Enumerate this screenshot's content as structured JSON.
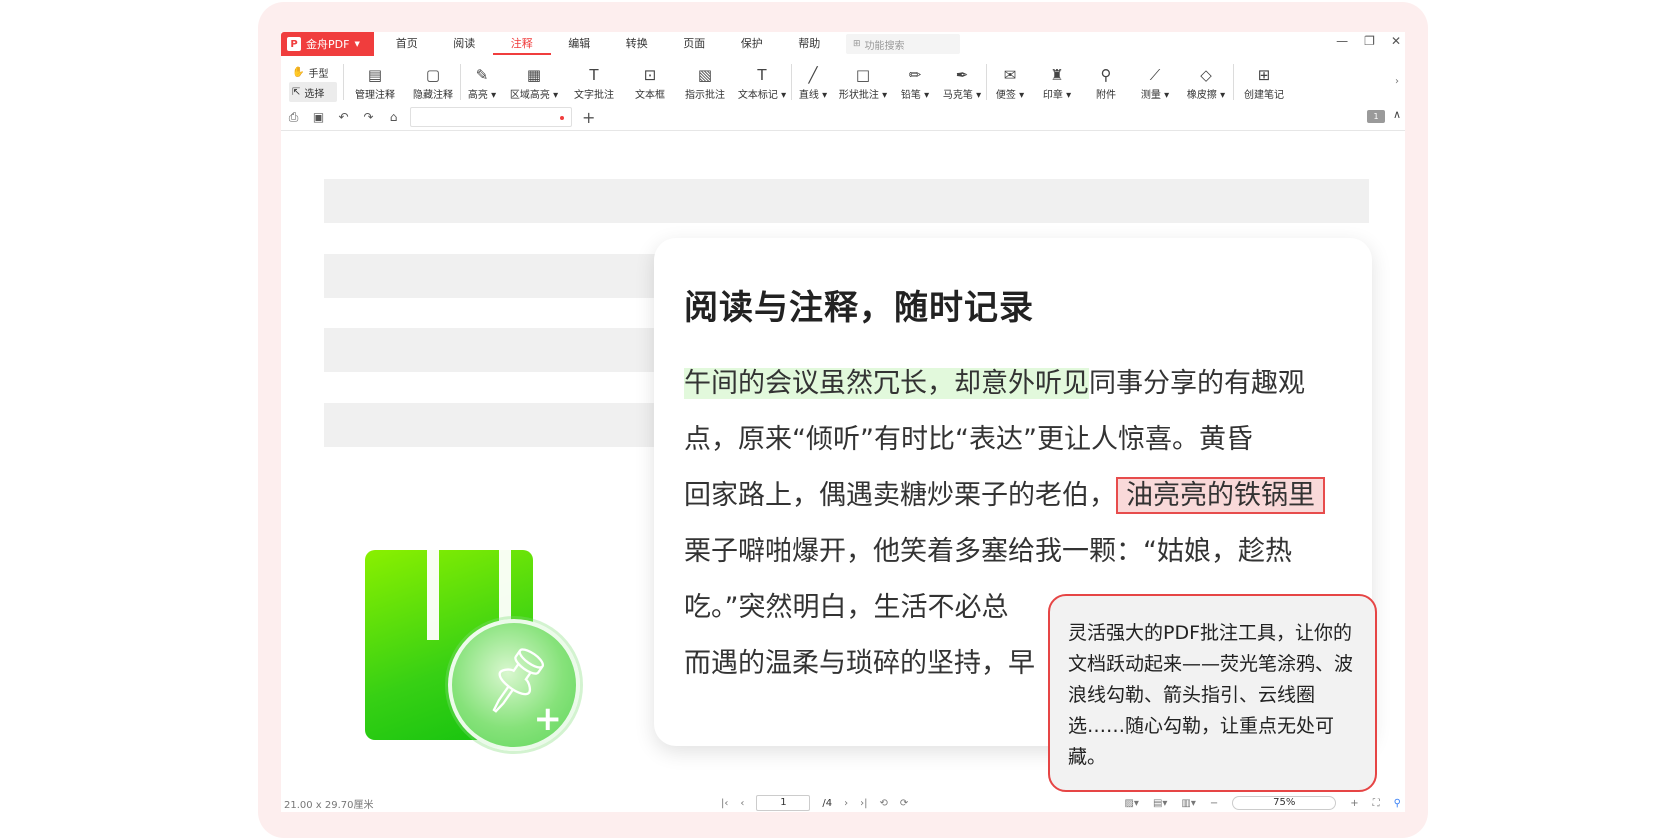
{
  "app": {
    "brand": "金舟PDF",
    "brand_logo": "P",
    "menu": [
      "首页",
      "阅读",
      "注释",
      "编辑",
      "转换",
      "页面",
      "保护",
      "帮助"
    ],
    "active_menu": "注释",
    "search_placeholder": "功能搜索",
    "window_controls": [
      "—",
      "❐",
      "✕"
    ]
  },
  "toolbar": {
    "modes": [
      {
        "label": "手型",
        "icon": "hand-icon"
      },
      {
        "label": "选择",
        "icon": "cursor-icon"
      }
    ],
    "tools": [
      {
        "label": "管理注释",
        "icon": "manage-annot-icon",
        "glyph": "▤"
      },
      {
        "label": "隐藏注释",
        "icon": "hide-annot-icon",
        "glyph": "▢"
      },
      {
        "label": "高亮 ▾",
        "icon": "highlight-icon",
        "glyph": "✎"
      },
      {
        "label": "区域高亮 ▾",
        "icon": "area-highlight-icon",
        "glyph": "▦"
      },
      {
        "label": "文字批注",
        "icon": "text-annot-icon",
        "glyph": "T"
      },
      {
        "label": "文本框",
        "icon": "textbox-icon",
        "glyph": "⊡"
      },
      {
        "label": "指示批注",
        "icon": "callout-icon",
        "glyph": "▧"
      },
      {
        "label": "文本标记 ▾",
        "icon": "text-mark-icon",
        "glyph": "T"
      },
      {
        "label": "直线 ▾",
        "icon": "line-icon",
        "glyph": "╱"
      },
      {
        "label": "形状批注 ▾",
        "icon": "shape-icon",
        "glyph": "□"
      },
      {
        "label": "铅笔 ▾",
        "icon": "pencil-icon",
        "glyph": "✏"
      },
      {
        "label": "马克笔 ▾",
        "icon": "marker-icon",
        "glyph": "✒"
      },
      {
        "label": "便签 ▾",
        "icon": "sticky-note-icon",
        "glyph": "✉"
      },
      {
        "label": "印章 ▾",
        "icon": "stamp-icon",
        "glyph": "♜"
      },
      {
        "label": "附件",
        "icon": "attachment-icon",
        "glyph": "⚲"
      },
      {
        "label": "测量 ▾",
        "icon": "measure-icon",
        "glyph": "⟋"
      },
      {
        "label": "橡皮擦 ▾",
        "icon": "eraser-icon",
        "glyph": "◇"
      },
      {
        "label": "创建笔记",
        "icon": "create-note-icon",
        "glyph": "⊞"
      }
    ]
  },
  "subbar": {
    "icons": [
      "print-icon",
      "save-icon",
      "undo-icon",
      "redo-icon",
      "home-icon"
    ],
    "glyphs": [
      "⎙",
      "▣",
      "↶",
      "↷",
      "⌂"
    ],
    "add_tab": "+",
    "page_badge": "1",
    "collapse": "∧"
  },
  "card": {
    "title": "阅读与注释，随时记录",
    "line1_hl": "午间的会议虽然冗长，却意外听见",
    "line1_rest": "同事分享的有趣观",
    "line2": "点，原来“倾听”有时比“表达”更让人惊喜。黄昏",
    "line3_pre": "回家路上，偶遇卖糖炒栗子的老伯，",
    "line3_box": "油亮亮的铁锅里",
    "line4": "栗子噼啪爆开，他笑着多塞给我一颗：“姑娘，趁热",
    "line5": "吃。”突然明白，生活不必总",
    "line6": "而遇的温柔与琐碎的坚持，早"
  },
  "callout": {
    "text": "灵活强大的PDF批注工具，让你的文档跃动起来——荧光笔涂鸦、波浪线勾勒、箭头指引、云线圈选……随心勾勒，让重点无处可藏。"
  },
  "status": {
    "dimensions": "21.00 x 29.70厘米",
    "current_page": "1",
    "total_pages": "/4",
    "zoom": "75%"
  },
  "colors": {
    "accent": "#f03d3d",
    "highlight_green": "#e2f9dc",
    "highlight_red_fill": "#f9d9d9",
    "brand_green": "#37d014"
  }
}
